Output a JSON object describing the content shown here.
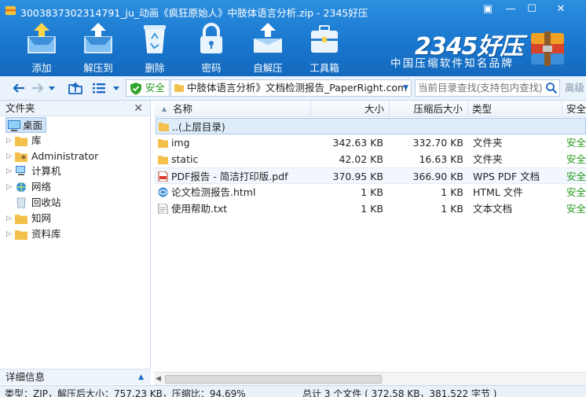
{
  "window": {
    "title": "3003837302314791_ju_动画《疯狂原始人》中肢体语言分析.zip - 2345好压",
    "controls": [
      "▣",
      "—",
      "☐",
      "✕"
    ]
  },
  "toolbar": {
    "buttons": [
      {
        "label": "添加",
        "icon": "add-box-icon"
      },
      {
        "label": "解压到",
        "icon": "extract-icon"
      },
      {
        "label": "删除",
        "icon": "recycle-bin-icon"
      },
      {
        "label": "密码",
        "icon": "lock-icon"
      },
      {
        "label": "自解压",
        "icon": "self-extract-icon"
      },
      {
        "label": "工具箱",
        "icon": "toolbox-icon"
      }
    ]
  },
  "brand": {
    "name": "2345好压",
    "slogan": "中国压缩软件知名品牌"
  },
  "address": {
    "safe_label": "安全",
    "path": "中肢体语言分析》文档检测报告_PaperRight.com",
    "search_placeholder": "当前目录查找(支持包内查找)",
    "advanced_label": "高级"
  },
  "left_pane": {
    "header": "文件夹",
    "tree": [
      {
        "label": "桌面",
        "icon": "desktop-icon"
      },
      {
        "label": "库",
        "icon": "library-icon"
      },
      {
        "label": "Administrator",
        "icon": "user-folder-icon"
      },
      {
        "label": "计算机",
        "icon": "computer-icon"
      },
      {
        "label": "网络",
        "icon": "network-icon"
      },
      {
        "label": "回收站",
        "icon": "recycle-bin-icon"
      },
      {
        "label": "知网",
        "icon": "folder-icon"
      },
      {
        "label": "资料库",
        "icon": "folder-icon"
      }
    ],
    "detail_header": "详细信息"
  },
  "file_list": {
    "columns": {
      "name": "名称",
      "size": "大小",
      "packed": "压缩后大小",
      "type": "类型",
      "safety": "安全"
    },
    "parent_label": "..(上层目录)",
    "rows": [
      {
        "name": "img",
        "size": "342.63 KB",
        "packed": "332.70 KB",
        "type": "文件夹",
        "safety": "安全",
        "icon": "folder-icon"
      },
      {
        "name": "static",
        "size": "42.02 KB",
        "packed": "16.63 KB",
        "type": "文件夹",
        "safety": "安全",
        "icon": "folder-icon"
      },
      {
        "name": "PDF报告 - 简洁打印版.pdf",
        "size": "370.95 KB",
        "packed": "366.90 KB",
        "type": "WPS PDF 文档",
        "safety": "安全",
        "icon": "pdf-icon"
      },
      {
        "name": "论文检测报告.html",
        "size": "1 KB",
        "packed": "1 KB",
        "type": "HTML 文件",
        "safety": "安全",
        "icon": "html-icon"
      },
      {
        "name": "使用帮助.txt",
        "size": "1 KB",
        "packed": "1 KB",
        "type": "文本文档",
        "safety": "安全",
        "icon": "text-file-icon"
      }
    ]
  },
  "status": {
    "left": "类型：ZIP，解压后大小：757.23 KB，压缩比：94.69%",
    "right": "总计 3 个文件 ( 372.58 KB，381,522 字节 )"
  },
  "colors": {
    "accent": "#1a78cf",
    "safe_green": "#2a9a22",
    "selection": "#dfedfb"
  }
}
